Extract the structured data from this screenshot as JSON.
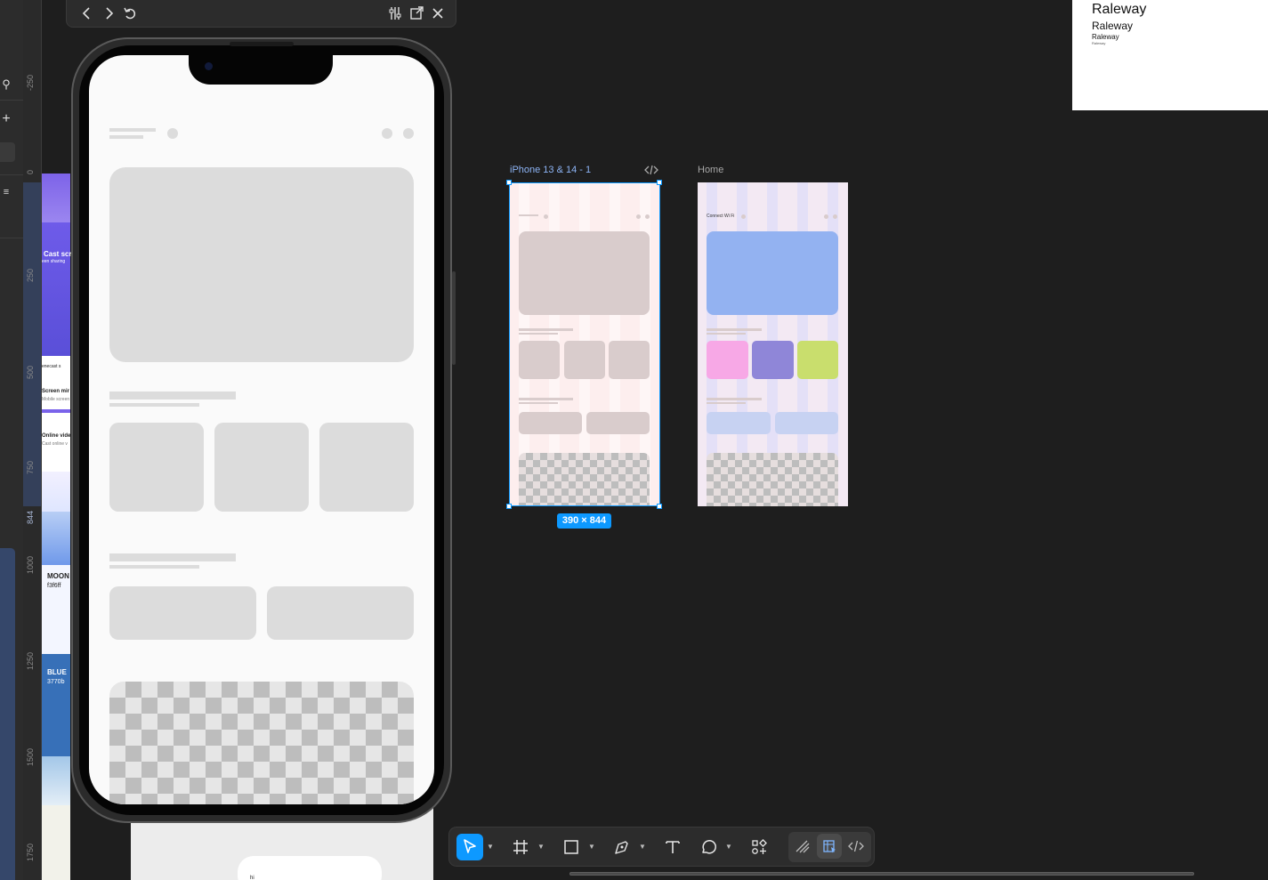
{
  "app": {
    "accent": "#0d99ff",
    "canvas_bg": "#1e1e1e"
  },
  "ruler": {
    "labels": [
      "-250",
      "0",
      "250",
      "500",
      "750",
      "844",
      "1000",
      "1250",
      "1500",
      "1750"
    ]
  },
  "background_design": {
    "texts": [
      "Cast scr",
      "een sharing",
      "ose",
      "enecast s",
      "Screen mir",
      "Mobile screen",
      "Online vide",
      "Cast online v",
      "MOON",
      "f3f6ff",
      "BLUE",
      "3770b",
      "hi"
    ]
  },
  "prototype_toolbar": {
    "back_icon": "chevron-left-icon",
    "forward_icon": "chevron-right-icon",
    "restart_icon": "restart-icon",
    "settings_icon": "sliders-icon",
    "open_icon": "open-external-icon",
    "close_icon": "close-icon"
  },
  "frames": [
    {
      "label": "iPhone 13 & 14 - 1",
      "selected": true,
      "size_badge": "390 × 844",
      "code_icon": "code-icon"
    },
    {
      "label": "Home",
      "selected": false,
      "heading_text": "Connect Wi Fi"
    }
  ],
  "font_preview": {
    "lines": [
      "Raleway",
      "Raleway",
      "Raleway",
      "Raleway"
    ]
  },
  "bottom_toolbar": {
    "tools": [
      {
        "name": "move-tool",
        "icon": "cursor-icon",
        "active": true
      },
      {
        "name": "frame-tool",
        "icon": "frame-icon",
        "active": false
      },
      {
        "name": "rectangle-tool",
        "icon": "rectangle-icon",
        "active": false
      },
      {
        "name": "pen-tool",
        "icon": "pen-icon",
        "active": false
      },
      {
        "name": "text-tool",
        "icon": "text-icon",
        "active": false
      },
      {
        "name": "comment-tool",
        "icon": "comment-icon",
        "active": false
      },
      {
        "name": "resources-tool",
        "icon": "resources-icon",
        "active": false
      }
    ],
    "modes": [
      {
        "name": "draw-mode",
        "icon": "draw-icon",
        "active": false
      },
      {
        "name": "design-mode",
        "icon": "design-mode-icon",
        "active": true
      },
      {
        "name": "dev-mode",
        "icon": "code-icon",
        "active": false
      }
    ]
  }
}
